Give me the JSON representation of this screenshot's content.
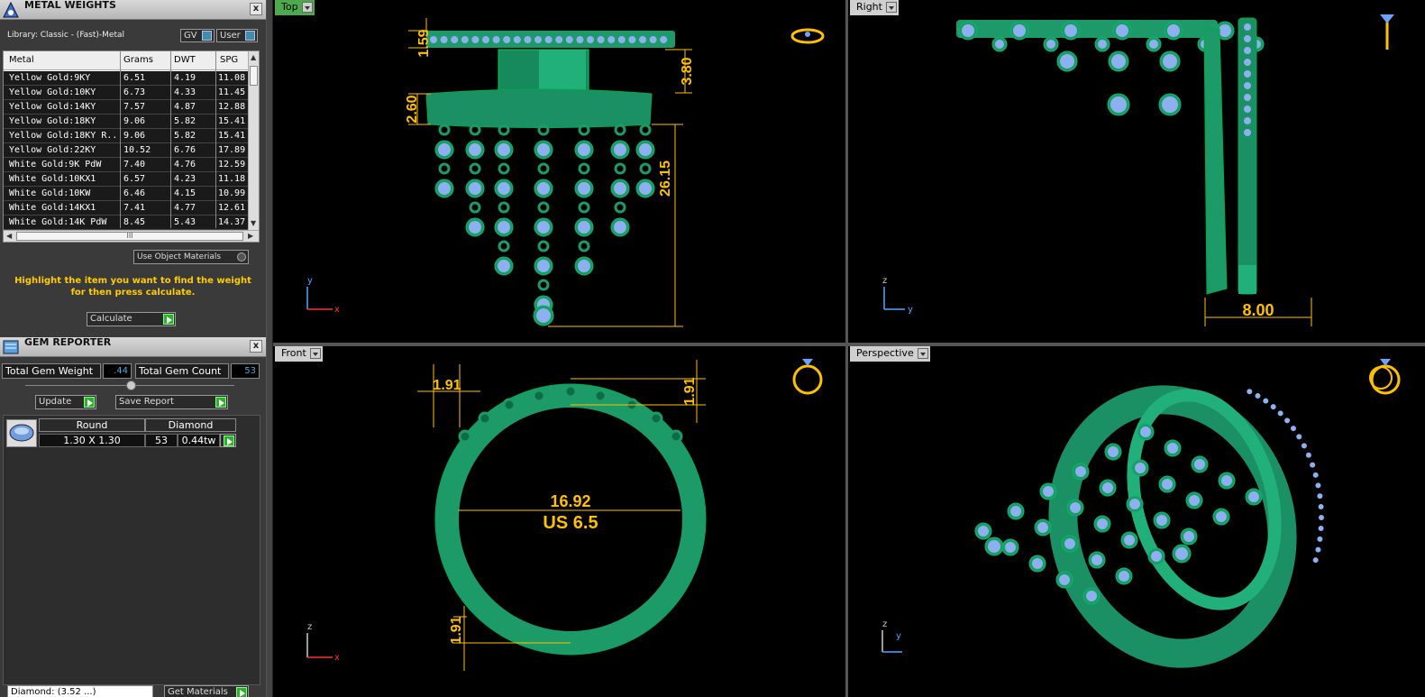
{
  "metal_panel": {
    "title": "METAL WEIGHTS",
    "close": "x",
    "library": "Library: Classic - (Fast)-Metal",
    "gv_label": "GV",
    "user_label": "User",
    "columns": [
      "Metal",
      "Grams",
      "DWT",
      "SPG"
    ],
    "rows": [
      [
        "Yellow Gold:9KY",
        "6.51",
        "4.19",
        "11.08"
      ],
      [
        "Yellow Gold:10KY",
        "6.73",
        "4.33",
        "11.45"
      ],
      [
        "Yellow Gold:14KY",
        "7.57",
        "4.87",
        "12.88"
      ],
      [
        "Yellow Gold:18KY",
        "9.06",
        "5.82",
        "15.41"
      ],
      [
        "Yellow Gold:18KY R...",
        "9.06",
        "5.82",
        "15.41"
      ],
      [
        "Yellow Gold:22KY",
        "10.52",
        "6.76",
        "17.89"
      ],
      [
        "White Gold:9K PdW",
        "7.40",
        "4.76",
        "12.59"
      ],
      [
        "White Gold:10KX1",
        "6.57",
        "4.23",
        "11.18"
      ],
      [
        "White Gold:10KW",
        "6.46",
        "4.15",
        "10.99"
      ],
      [
        "White Gold:14KX1",
        "7.41",
        "4.77",
        "12.61"
      ],
      [
        "White Gold:14K PdW",
        "8.45",
        "5.43",
        "14.37"
      ]
    ],
    "hscroll_grip": "III",
    "use_object_materials": "Use Object Materials",
    "hint": "Highlight the item you want to find the weight for then press calculate.",
    "calculate": "Calculate"
  },
  "gem_panel": {
    "title": "GEM REPORTER",
    "close": "x",
    "total_weight_label": "Total Gem Weight",
    "total_weight_value": ".44",
    "total_count_label": "Total Gem Count",
    "total_count_value": "53",
    "update": "Update",
    "save_report": "Save Report",
    "headers": [
      "Round",
      "Diamond"
    ],
    "row": {
      "size": "1.30 X 1.30",
      "count": "53",
      "weight": "0.44tw"
    }
  },
  "bottom": {
    "left_field": "Diamond: (3.52 ...)",
    "right_btn": "Get Materials"
  },
  "viewports": {
    "top": {
      "label": "Top",
      "dims": [
        "1.59",
        "3.80",
        "2.60",
        "26.15"
      ],
      "axis": [
        "y",
        "x"
      ]
    },
    "right": {
      "label": "Right",
      "dims": [
        "8.00"
      ],
      "axis": [
        "z",
        "y"
      ]
    },
    "front": {
      "label": "Front",
      "dims": [
        "1.91",
        "1.91",
        "16.92",
        "US 6.5",
        "1.91"
      ],
      "axis": [
        "z",
        "x"
      ]
    },
    "perspective": {
      "label": "Perspective",
      "axis": [
        "z",
        "y"
      ]
    }
  },
  "colors": {
    "metal": "#1e9a6a",
    "gem": "#8db0ee",
    "dim": "#ffc000",
    "active_tab": "#4caa4c",
    "tab": "#d0d0d0"
  }
}
